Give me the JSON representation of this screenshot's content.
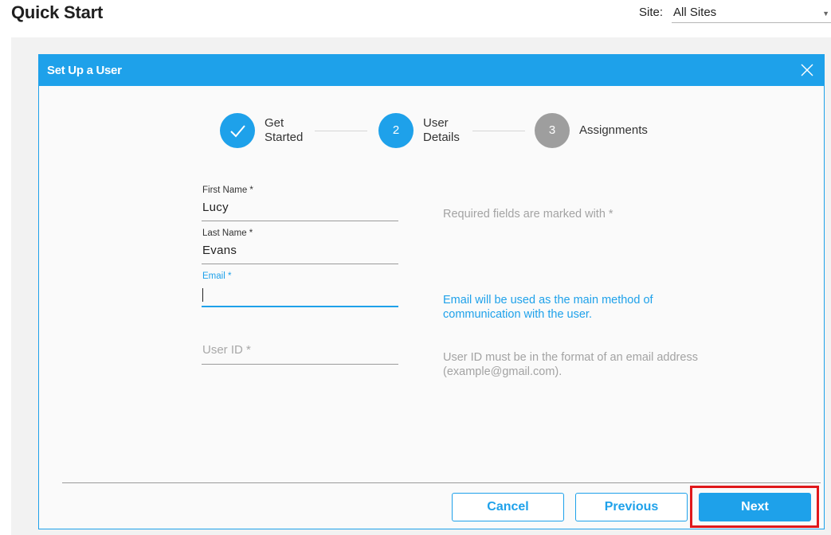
{
  "header": {
    "title": "Quick Start",
    "site_label": "Site:",
    "site_value": "All Sites"
  },
  "modal": {
    "title": "Set Up a User",
    "close_icon": "close-icon"
  },
  "stepper": {
    "steps": [
      {
        "number": "",
        "label_line1": "Get",
        "label_line2": "Started",
        "state": "completed",
        "icon": "checkmark-icon"
      },
      {
        "number": "2",
        "label_line1": "User",
        "label_line2": "Details",
        "state": "active"
      },
      {
        "number": "3",
        "label_line1": "Assignments",
        "label_line2": "",
        "state": "pending"
      }
    ],
    "colors": {
      "active": "#1ea1ea",
      "pending": "#9e9e9e"
    }
  },
  "form": {
    "first_name": {
      "label": "First Name *",
      "value": "Lucy"
    },
    "last_name": {
      "label": "Last Name *",
      "value": "Evans"
    },
    "email": {
      "label": "Email *",
      "value": ""
    },
    "user_id": {
      "placeholder": "User ID *",
      "value": ""
    }
  },
  "hints": {
    "required": "Required fields are marked with *",
    "email_line1": "Email will be used as the main method of",
    "email_line2": "communication with the user.",
    "userid_line1": "User ID must be in the format of an email address",
    "userid_line2": "(example@gmail.com)."
  },
  "footer": {
    "cancel_label": "Cancel",
    "previous_label": "Previous",
    "next_label": "Next"
  },
  "colors": {
    "accent": "#1ea1ea",
    "highlight": "#e0181b"
  }
}
